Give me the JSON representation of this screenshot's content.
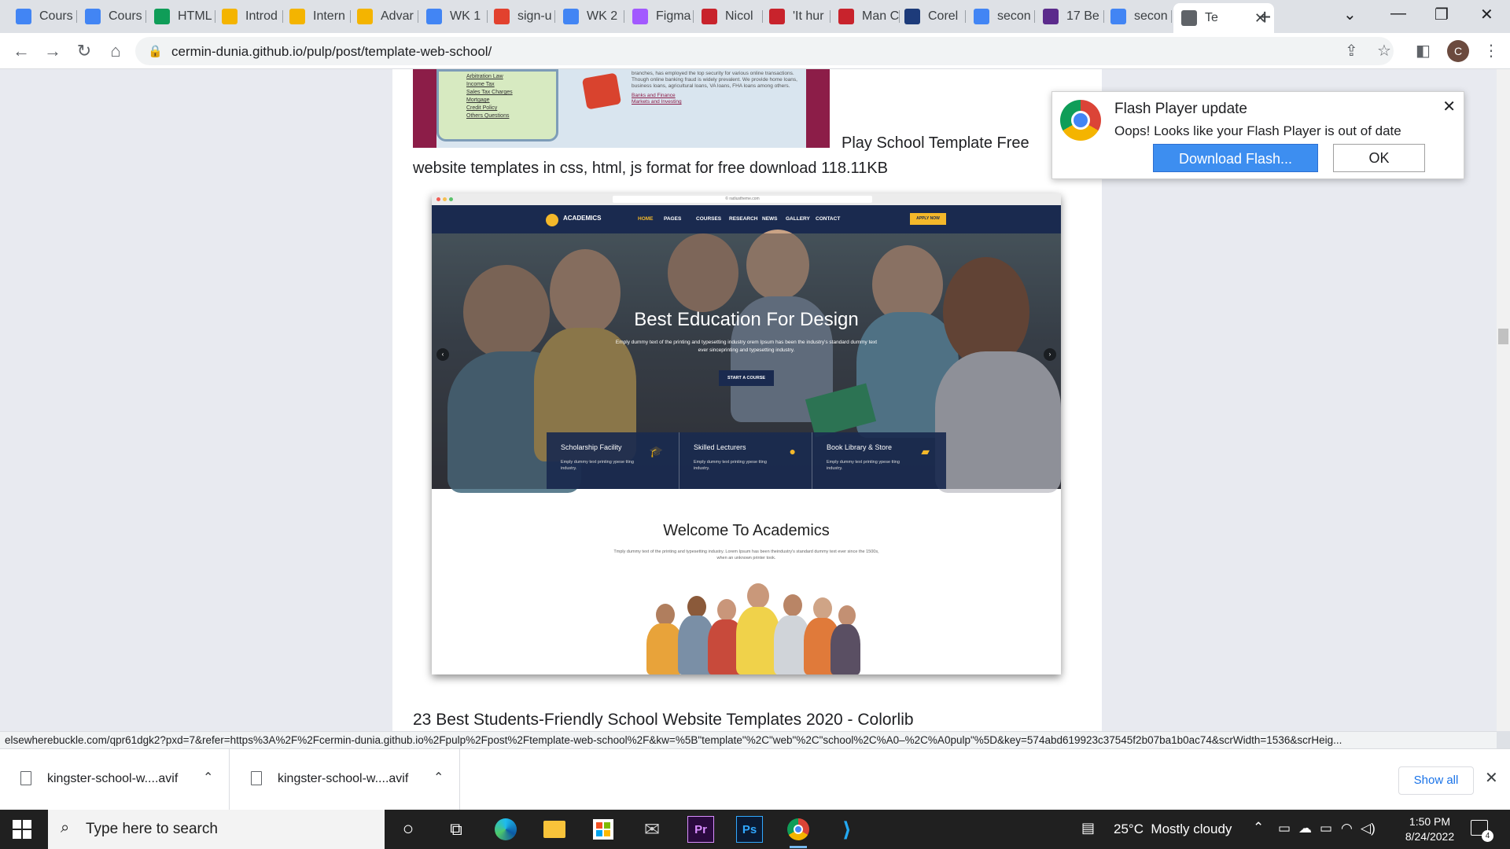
{
  "tabs": [
    {
      "title": "Cours",
      "icon": "google-docs-icon",
      "color": "#4285f4"
    },
    {
      "title": "Cours",
      "icon": "google-docs-icon",
      "color": "#4285f4"
    },
    {
      "title": "HTML",
      "icon": "google-drive-icon",
      "color": "#0f9d58"
    },
    {
      "title": "Introd",
      "icon": "google-slides-icon",
      "color": "#f4b400"
    },
    {
      "title": "Intern",
      "icon": "google-slides-icon",
      "color": "#f4b400"
    },
    {
      "title": "Advar",
      "icon": "google-slides-icon",
      "color": "#f4b400"
    },
    {
      "title": "WK 1",
      "icon": "google-docs-icon",
      "color": "#4285f4"
    },
    {
      "title": "sign-u",
      "icon": "flash-icon",
      "color": "#e2412e"
    },
    {
      "title": "WK 2",
      "icon": "google-docs-icon",
      "color": "#4285f4"
    },
    {
      "title": "Figma",
      "icon": "figma-icon",
      "color": "#a259ff"
    },
    {
      "title": "Nicol",
      "icon": "video-icon",
      "color": "#c8232c"
    },
    {
      "title": "'It hur",
      "icon": "video-icon",
      "color": "#c8232c"
    },
    {
      "title": "Man C",
      "icon": "video-icon",
      "color": "#c8232c"
    },
    {
      "title": "Corel",
      "icon": "corel-icon",
      "color": "#1d3b7a"
    },
    {
      "title": "secon",
      "icon": "google-icon",
      "color": "#4285f4"
    },
    {
      "title": "17 Be",
      "icon": "colorlib-icon",
      "color": "#5b2b8c"
    },
    {
      "title": "secon",
      "icon": "google-icon",
      "color": "#4285f4"
    },
    {
      "title": "Te",
      "icon": "globe-icon",
      "color": "#5f6368",
      "active": true
    }
  ],
  "toolbar": {
    "url": "cermin-dunia.github.io/pulp/post/template-web-school/",
    "avatar_initial": "C"
  },
  "page": {
    "caption1": "Play School Template Free website templates in css, html, js format for free download 118.11KB",
    "top_image_links": [
      "Arbitration Law",
      "Income Tax",
      "Sales Tax Charges",
      "Mortgage",
      "Credit Policy",
      "Others Questions"
    ],
    "top_image_text": "branches, has employed the top security for various online transactions. Though online banking fraud is widely prevalent. We provide home loans, business loans, agricultural loans, VA loans, FHA loans among others.",
    "top_image_bullets": [
      "Banks and Finance",
      "Markets and Investing"
    ],
    "caption2": "23 Best Students-Friendly School Website Templates 2020 - Colorlib"
  },
  "shot": {
    "address": "© radiustheme.com",
    "brand": "ACADEMICS",
    "nav": [
      "HOME",
      "PAGES",
      "COURSES",
      "RESEARCH",
      "NEWS",
      "GALLERY",
      "CONTACT"
    ],
    "apply": "APPLY NOW",
    "hero_title": "Best Education For Design",
    "hero_sub": "Emply dummy text of the printing and typesetting industry orem Ipsum has been the industry's standard dummy text ever sinceprinting and typesetting industry.",
    "hero_btn": "START A COURSE",
    "features": [
      {
        "title": "Scholarship Facility",
        "desc": "Emply dummy text printing ypese tting industry.",
        "icon": "graduation-cap-icon"
      },
      {
        "title": "Skilled Lecturers",
        "desc": "Emply dummy text printing ypese tting industry.",
        "icon": "user-icon"
      },
      {
        "title": "Book Library & Store",
        "desc": "Emply dummy text printing ypese tting industry.",
        "icon": "book-icon"
      }
    ],
    "welcome_title": "Welcome To Academics",
    "welcome_sub": "Tmply dummy text of the printing and typesetting industry. Lorem Ipsum has been theindustry's standard dummy text ever since the 1500s, when an unknown printer took."
  },
  "flash": {
    "title": "Flash Player update",
    "message": "Oops! Looks like your Flash Player is out of date",
    "download_label": "Download Flash...",
    "ok_label": "OK"
  },
  "statusbar": {
    "text": "elsewherebuckle.com/qpr61dgk2?pxd=7&refer=https%3A%2F%2Fcermin-dunia.github.io%2Fpulp%2Fpost%2Ftemplate-web-school%2F&kw=%5B\"template\"%2C\"web\"%2C\"school%2C%A0–%2C%A0pulp\"%5D&key=574abd619923c37545f2b07ba1b0ac74&scrWidth=1536&scrHeig..."
  },
  "downloads": {
    "items": [
      "kingster-school-w....avif",
      "kingster-school-w....avif"
    ],
    "show_all": "Show all"
  },
  "taskbar": {
    "search_placeholder": "Type here to search",
    "apps": [
      {
        "name": "cortana",
        "label": "○"
      },
      {
        "name": "task-view",
        "label": "⧉"
      },
      {
        "name": "edge",
        "label": "e"
      },
      {
        "name": "file-explorer",
        "label": ""
      },
      {
        "name": "store",
        "label": ""
      },
      {
        "name": "mail",
        "label": "✉"
      },
      {
        "name": "premiere",
        "label": "Pr"
      },
      {
        "name": "photoshop",
        "label": "Ps"
      },
      {
        "name": "chrome",
        "label": ""
      },
      {
        "name": "vscode",
        "label": "⟩"
      }
    ],
    "weather": "25°C  Mostly cloudy",
    "time": "1:50 PM",
    "date": "8/24/2022",
    "notifications": "4"
  }
}
